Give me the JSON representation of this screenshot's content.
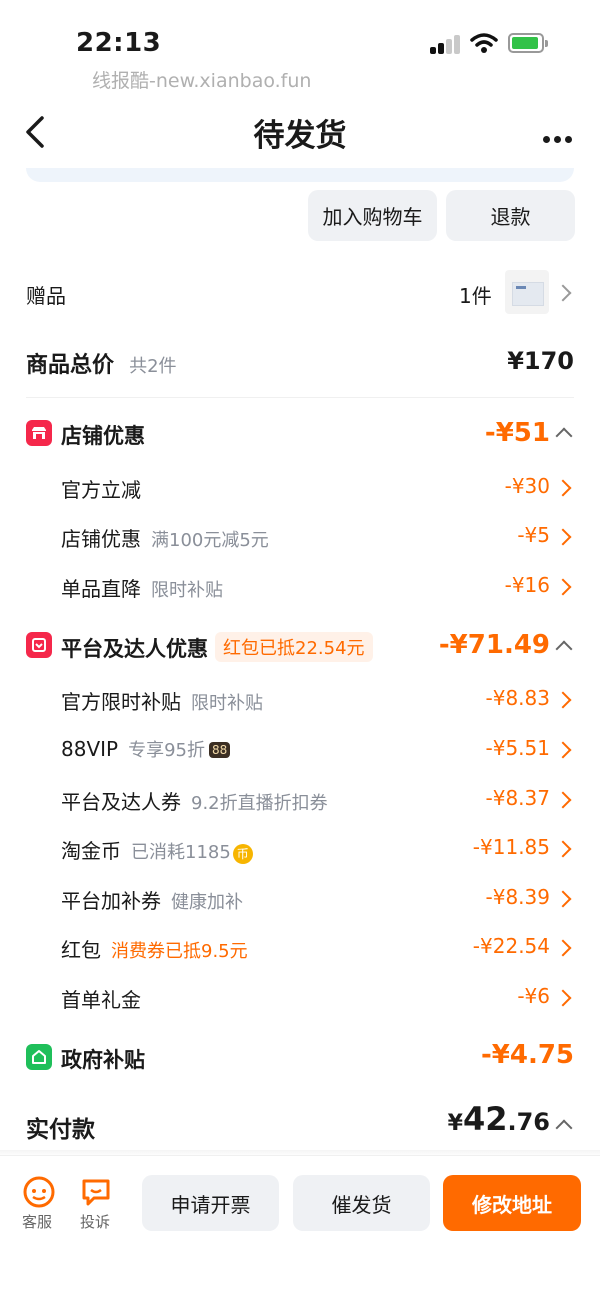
{
  "status": {
    "time": "22:13",
    "watermark": "线报酷-new.xianbao.fun"
  },
  "nav": {
    "title": "待发货"
  },
  "actions": {
    "add_cart": "加入购物车",
    "refund": "退款"
  },
  "gift": {
    "label": "赠品",
    "count": "1件"
  },
  "total": {
    "label": "商品总价",
    "sub": "共2件",
    "value": "¥170"
  },
  "shop_discount": {
    "title": "店铺优惠",
    "value": "-¥51",
    "items": [
      {
        "label": "官方立减",
        "note": "",
        "value": "-¥30"
      },
      {
        "label": "店铺优惠",
        "note": "满100元减5元",
        "value": "-¥5"
      },
      {
        "label": "单品直降",
        "note": "限时补贴",
        "value": "-¥16"
      }
    ]
  },
  "platform_discount": {
    "title": "平台及达人优惠",
    "tag": "红包已抵22.54元",
    "value": "-¥71.49",
    "items": [
      {
        "label": "官方限时补贴",
        "note": "限时补贴",
        "value": "-¥8.83"
      },
      {
        "label": "88VIP",
        "note": "专享95折",
        "badge": "88",
        "value": "-¥5.51"
      },
      {
        "label": "平台及达人券",
        "note": "9.2折直播折扣券",
        "value": "-¥8.37"
      },
      {
        "label": "淘金币",
        "note": "已消耗1185",
        "coin": "币",
        "value": "-¥11.85"
      },
      {
        "label": "平台加补券",
        "note": "健康加补",
        "value": "-¥8.39"
      },
      {
        "label": "红包",
        "note": "消费券已抵9.5元",
        "value": "-¥22.54"
      },
      {
        "label": "首单礼金",
        "note": "",
        "value": "-¥6"
      }
    ]
  },
  "gov": {
    "title": "政府补贴",
    "value": "-¥4.75"
  },
  "paid": {
    "label": "实付款",
    "currency": "¥",
    "int": "42",
    "dec": ".76"
  },
  "bottom": {
    "service": "客服",
    "complain": "投诉",
    "invoice": "申请开票",
    "urge": "催发货",
    "address": "修改地址"
  },
  "colors": {
    "accent": "#ff6a00",
    "shop_icon": "#f5284b",
    "gov_icon": "#1fbf5a"
  }
}
